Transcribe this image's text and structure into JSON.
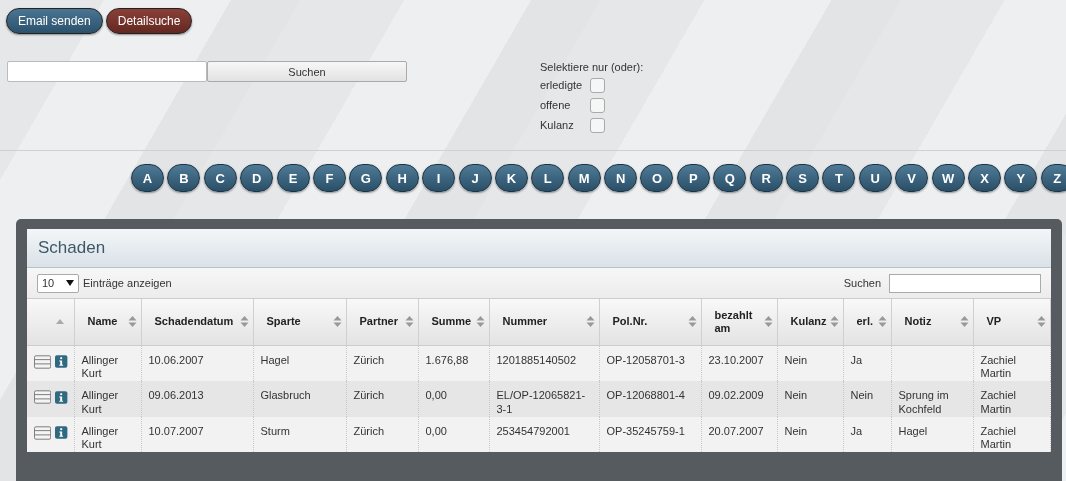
{
  "top_buttons": [
    {
      "label": "Email senden",
      "kind": "primary"
    },
    {
      "label": "Detailsuche",
      "kind": "danger"
    }
  ],
  "search": {
    "button": "Suchen"
  },
  "filter": {
    "title": "Selektiere nur (oder):",
    "options": [
      {
        "label": "erledigte",
        "checked": false
      },
      {
        "label": "offene",
        "checked": false
      },
      {
        "label": "Kulanz",
        "checked": false
      }
    ]
  },
  "letters": [
    "A",
    "B",
    "C",
    "D",
    "E",
    "F",
    "G",
    "H",
    "I",
    "J",
    "K",
    "L",
    "M",
    "N",
    "O",
    "P",
    "Q",
    "R",
    "S",
    "T",
    "U",
    "V",
    "W",
    "X",
    "Y",
    "Z"
  ],
  "panel": {
    "title": "Schaden",
    "page_size": "10",
    "page_size_label": "Einträge anzeigen",
    "search_label": "Suchen"
  },
  "table": {
    "icon_column": {
      "sorted": true
    },
    "columns": [
      {
        "label": "Name",
        "sorted": false
      },
      {
        "label": "Schadendatum",
        "sorted": false
      },
      {
        "label": "Sparte",
        "sorted": false
      },
      {
        "label": "Partner",
        "sorted": false
      },
      {
        "label": "Summe",
        "sorted": false
      },
      {
        "label": "Nummer",
        "sorted": false
      },
      {
        "label": "Pol.Nr.",
        "sorted": false
      },
      {
        "label": "bezahlt am",
        "sorted": false
      },
      {
        "label": "Kulanz",
        "sorted": false
      },
      {
        "label": "erl.",
        "sorted": false
      },
      {
        "label": "Notiz",
        "sorted": false
      },
      {
        "label": "VP",
        "sorted": false
      }
    ],
    "rows": [
      [
        "Allinger Kurt",
        "10.06.2007",
        "Hagel",
        "Zürich",
        "1.676,88",
        "1201885140502",
        "OP-12058701-3",
        "23.10.2007",
        "Nein",
        "Ja",
        "",
        "Zachiel Martin"
      ],
      [
        "Allinger Kurt",
        "09.06.2013",
        "Glasbruch",
        "Zürich",
        "0,00",
        "EL/OP-12065821-3-1",
        "OP-12068801-4",
        "09.02.2009",
        "Nein",
        "Nein",
        "Sprung im Kochfeld",
        "Zachiel Martin"
      ],
      [
        "Allinger Kurt",
        "10.07.2007",
        "Sturm",
        "Zürich",
        "0,00",
        "253454792001",
        "OP-35245759-1",
        "20.07.2007",
        "Nein",
        "Ja",
        "Hagel",
        "Zachiel Martin"
      ]
    ]
  }
}
